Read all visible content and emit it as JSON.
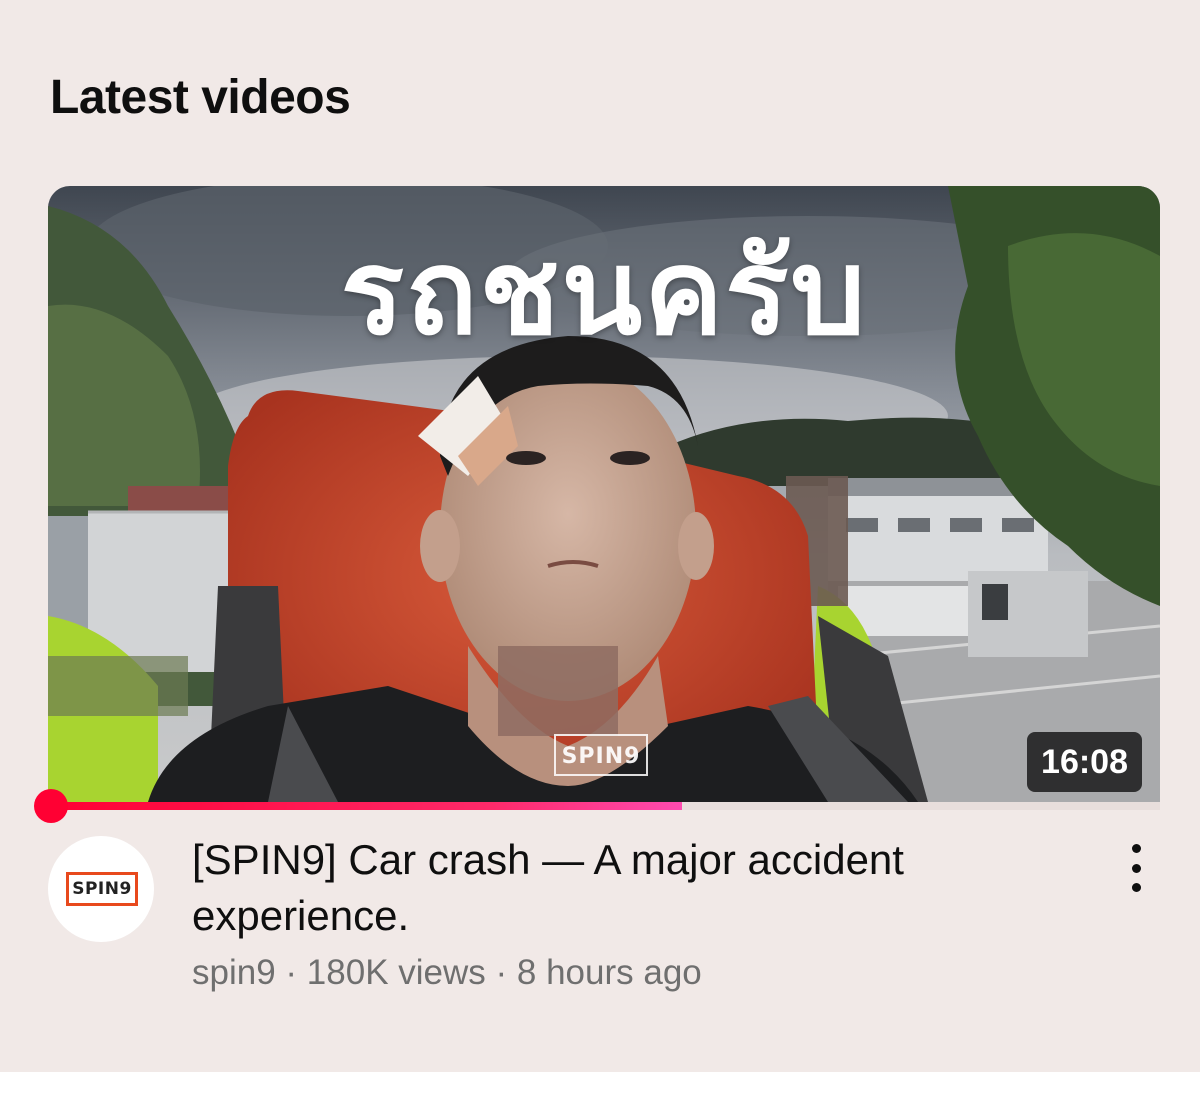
{
  "section": {
    "title": "Latest videos"
  },
  "video": {
    "thumbnail_headline": "รถชนครับ",
    "watermark_text": "SPIN9",
    "duration": "16:08",
    "watch_progress": 0.57,
    "title": "[SPIN9] Car crash — A major accident experience.",
    "channel": "spin9",
    "separator": "·",
    "views": "180K views",
    "age": "8 hours ago",
    "channel_logo_text": "SPIN9",
    "more_icon": "more-vert-icon"
  },
  "colors": {
    "page_background": "#f1e9e7",
    "progress_red": "#ff0033",
    "progress_pink": "#ff4bb0",
    "logo_orange": "#e8491d"
  }
}
